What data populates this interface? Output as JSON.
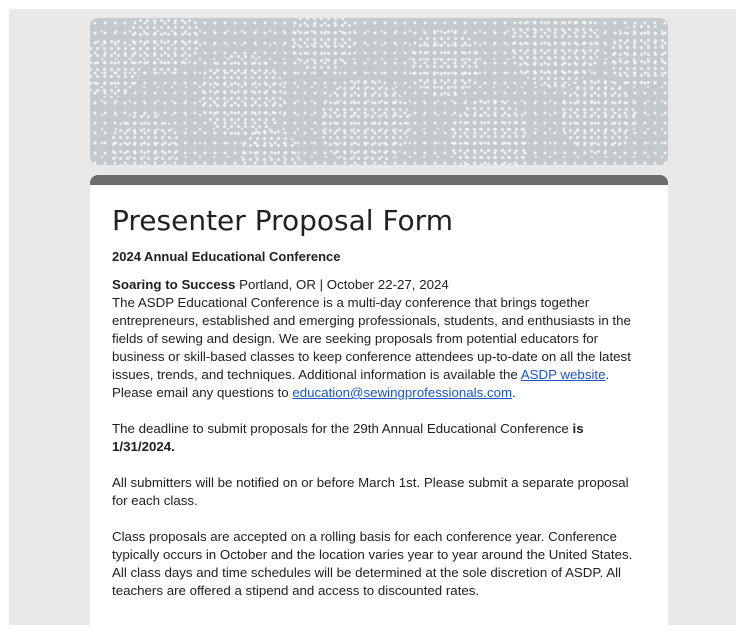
{
  "form": {
    "title": "Presenter Proposal Form",
    "subtitle": "2024 Annual Educational Conference",
    "intro": {
      "event_name": "Soaring to Success",
      "event_details": " Portland, OR | October 22-27, 2024",
      "description": "The ASDP Educational Conference is a multi-day conference that brings together entrepreneurs, established and emerging professionals, students, and enthusiasts in the fields of sewing and design. We are seeking proposals from potential educators for business or skill-based classes to keep conference attendees up-to-date on all the latest issues, trends, and techniques. Additional information is available the ",
      "website_link": "ASDP website",
      "after_link": ".",
      "email_prefix": "Please email any questions to ",
      "email_link": "education@sewingprofessionals.com",
      "email_suffix": "."
    },
    "deadline": {
      "prefix": "The deadline to submit proposals for the 29th Annual Educational Conference ",
      "emphasis": "is 1/31/2024."
    },
    "notification": "All submitters will be notified on or before March 1st. Please submit a separate proposal for each class.",
    "rolling": "Class proposals are accepted on a rolling basis for each conference year. Conference typically occurs in October and the location varies year to year around the United States. All class days and time schedules will be determined at the sole discretion of ASDP. All teachers are offered a stipend and access to discounted rates."
  },
  "colors": {
    "background": "#e9e9e9",
    "card_accent": "#6d6d6d",
    "link": "#1a55c4",
    "banner": "#c4c9cd"
  }
}
